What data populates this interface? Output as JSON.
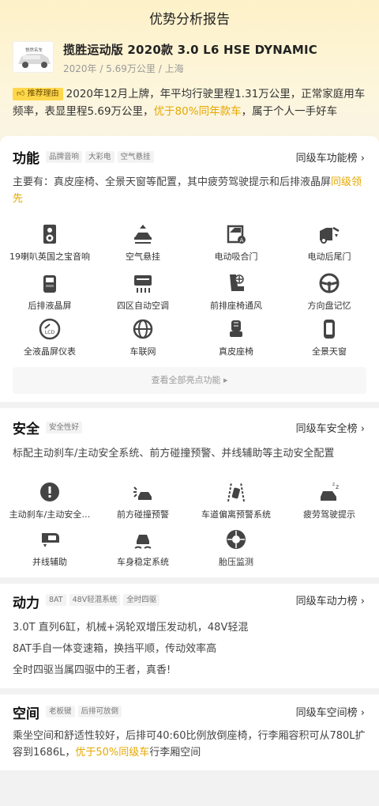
{
  "page_title": "优势分析报告",
  "car": {
    "name": "揽胜运动版 2020款 3.0 L6 HSE DYNAMIC",
    "meta": "2020年 / 5.69万公里 / 上海",
    "thumb_logo_text": "悦然名车"
  },
  "reason": {
    "tag": "推荐理由",
    "text_before": "2020年12月上牌，年平均行驶里程1.31万公里，正常家庭用车频率，表显里程5.69万公里，",
    "highlight": "优于80%同年款车",
    "text_after": "，属于个人一手好车"
  },
  "colors": {
    "accent": "#e6a800",
    "tag_bg": "#ffd74a",
    "hero_bg": "#fdf1c8"
  },
  "function": {
    "title": "功能",
    "tags": [
      "品牌音响",
      "大彩电",
      "空气悬挂"
    ],
    "rank": "同级车功能榜",
    "desc_before": "主要有：真皮座椅、全景天窗等配置，其中疲劳驾驶提示和后排液晶屏",
    "desc_highlight": "同级领先",
    "features": [
      {
        "label": "19喇叭英国之宝音响",
        "icon": "speaker-icon"
      },
      {
        "label": "空气悬挂",
        "icon": "air-suspension-icon"
      },
      {
        "label": "电动吸合门",
        "icon": "soft-close-door-icon"
      },
      {
        "label": "电动后尾门",
        "icon": "power-tailgate-icon"
      },
      {
        "label": "后排液晶屏",
        "icon": "rear-screen-icon"
      },
      {
        "label": "四区自动空调",
        "icon": "climate-control-icon"
      },
      {
        "label": "前排座椅通风",
        "icon": "seat-ventilation-icon"
      },
      {
        "label": "方向盘记忆",
        "icon": "steering-memory-icon"
      },
      {
        "label": "全液晶屏仪表",
        "icon": "lcd-dashboard-icon"
      },
      {
        "label": "车联网",
        "icon": "connected-car-icon"
      },
      {
        "label": "真皮座椅",
        "icon": "leather-seat-icon"
      },
      {
        "label": "全景天窗",
        "icon": "panoramic-sunroof-icon"
      }
    ],
    "view_all": "查看全部亮点功能"
  },
  "safety": {
    "title": "安全",
    "tags": [
      "安全性好"
    ],
    "rank": "同级车安全榜",
    "desc": "标配主动刹车/主动安全系统、前方碰撞预警、并线辅助等主动安全配置",
    "features": [
      {
        "label": "主动刹车/主动安全…",
        "icon": "active-brake-icon"
      },
      {
        "label": "前方碰撞预警",
        "icon": "collision-warning-icon"
      },
      {
        "label": "车道偏离预警系统",
        "icon": "lane-departure-icon"
      },
      {
        "label": "疲劳驾驶提示",
        "icon": "fatigue-alert-icon"
      },
      {
        "label": "并线辅助",
        "icon": "blind-spot-icon"
      },
      {
        "label": "车身稳定系统",
        "icon": "stability-control-icon"
      },
      {
        "label": "胎压监测",
        "icon": "tire-pressure-icon"
      }
    ]
  },
  "power": {
    "title": "动力",
    "tags": [
      "8AT",
      "48V轻混系统",
      "全时四驱"
    ],
    "rank": "同级车动力榜",
    "lines": [
      "3.0T 直列6缸，机械+涡轮双增压发动机，48V轻混",
      "8AT手自一体变速箱，换挡平顺，传动效率高",
      "全时四驱当属四驱中的王者，真香!"
    ]
  },
  "space": {
    "title": "空间",
    "tags": [
      "老板键",
      "后排可放倒"
    ],
    "rank": "同级车空间榜",
    "desc_before": "乘坐空间和舒适性较好，后排可40:60比例放倒座椅，行李厢容积可从780L扩容到1686L，",
    "desc_highlight": "优于50%同级车",
    "desc_after": "行李厢空间"
  }
}
